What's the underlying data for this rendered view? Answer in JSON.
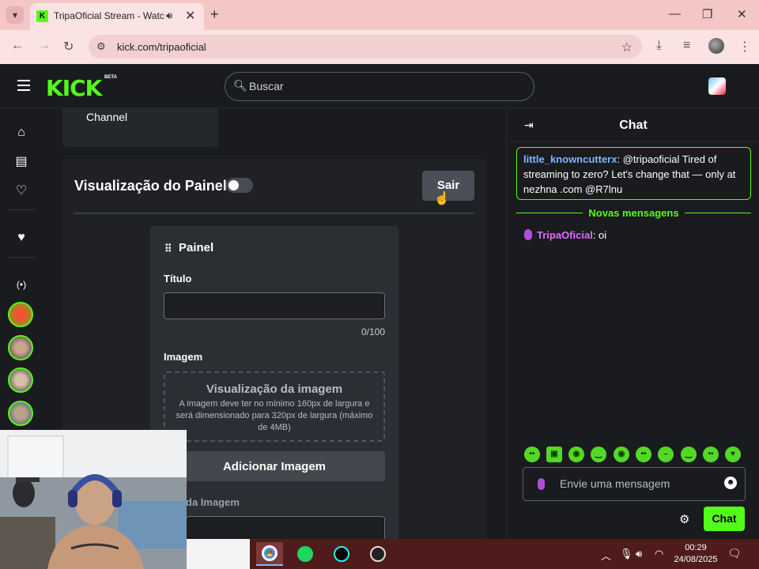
{
  "browser": {
    "tab_title": "TripaOficial Stream - Watch",
    "url": "kick.com/tripaoficial"
  },
  "header": {
    "logo": "KICK",
    "logo_badge": "BETA",
    "search_placeholder": "Buscar"
  },
  "main": {
    "channel_label": "Channel",
    "panel_view_title": "Visualização do Painel",
    "exit_button": "Sair",
    "panel": {
      "title": "Painel",
      "title_field_label": "Título",
      "title_counter": "0/100",
      "image_field_label": "Imagem",
      "image_preview_title": "Visualização da imagem",
      "image_preview_desc": "A imagem deve ter no mínimo 160px de largura e será dimensionado para 320px de largura (máximo de 4MB)",
      "add_image_button": "Adicionar Imagem",
      "image_link_label": "da Imagem"
    }
  },
  "chat": {
    "title": "Chat",
    "pinned": {
      "user": "little_knowncutterx",
      "text": ": @tripaoficial Tired of streaming to zero? Let's change that — only at nezhna .com @R7lnu"
    },
    "new_messages_label": "Novas mensagens",
    "messages": [
      {
        "user": "TripaOficial",
        "text": ": oi"
      }
    ],
    "input_placeholder": "Envie uma mensagem",
    "send_button": "Chat"
  },
  "taskbar": {
    "time": "00:29",
    "date": "24/08/2025"
  },
  "colors": {
    "brand": "#53fc18",
    "background": "#191b1f",
    "pinned_user": "#7fb6ff",
    "streamer_user": "#e36bff"
  }
}
